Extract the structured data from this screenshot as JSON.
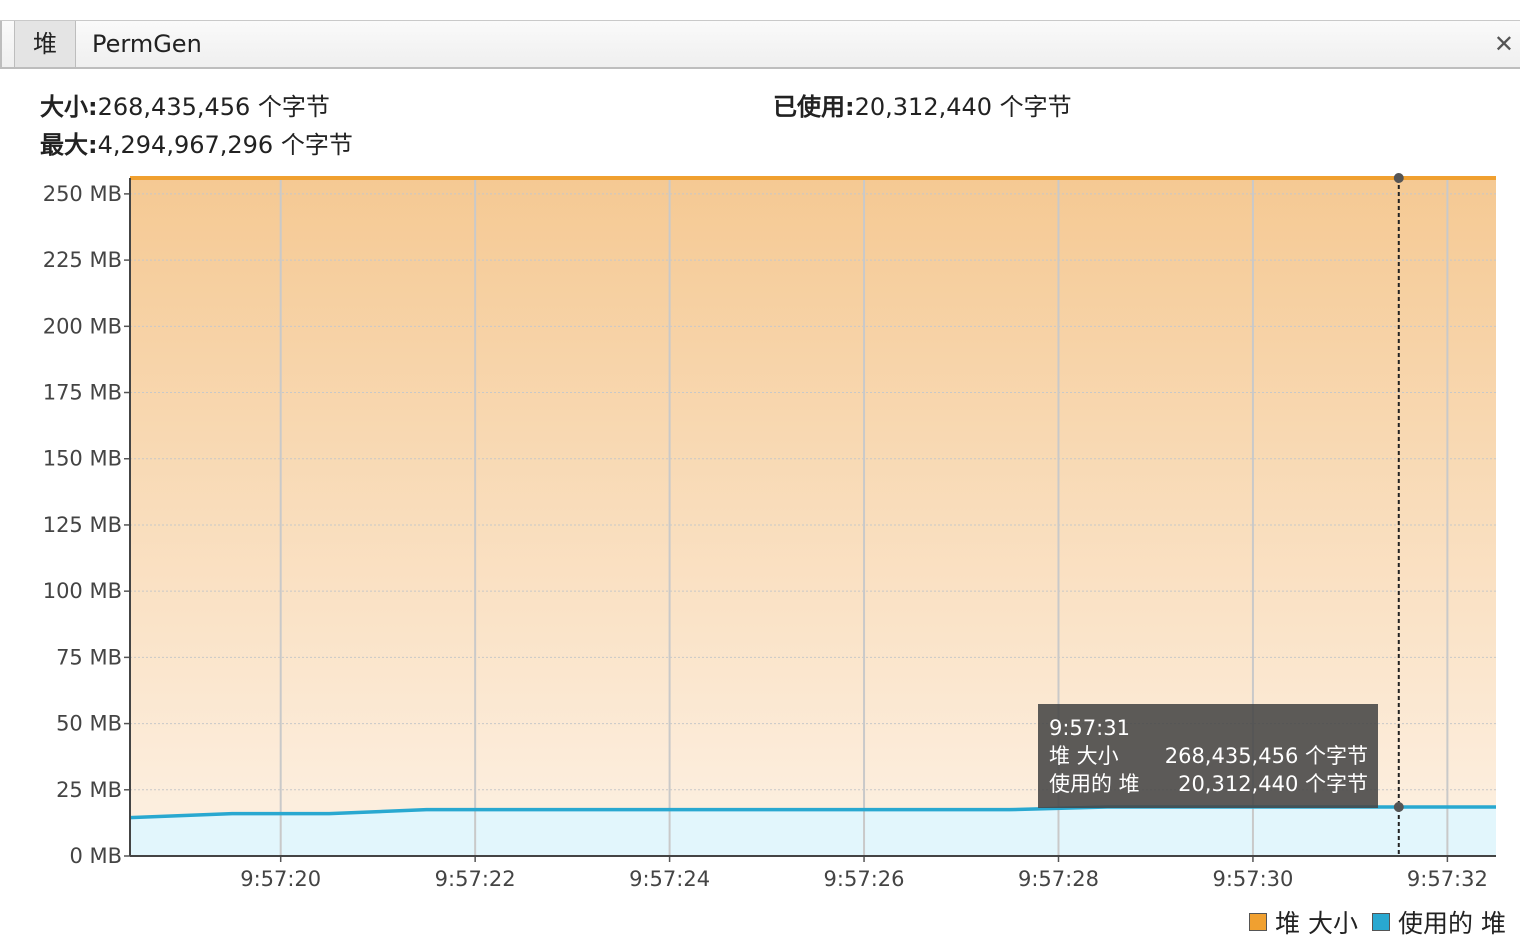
{
  "tabs": [
    {
      "label": "堆",
      "active": true
    },
    {
      "label": "PermGen",
      "active": false
    }
  ],
  "close_label": "✕",
  "stats": {
    "size_label": "大小:",
    "size_value": "268,435,456 个字节",
    "max_label": "最大:",
    "max_value": "4,294,967,296 个字节",
    "used_label": "已使用:",
    "used_value": "20,312,440 个字节"
  },
  "tooltip": {
    "time": "9:57:31",
    "row1_label": "堆 大小",
    "row1_value": "268,435,456 个字节",
    "row2_label": "使用的 堆",
    "row2_value": "20,312,440 个字节"
  },
  "legend": [
    {
      "label": "堆 大小",
      "color": "#f0a030"
    },
    {
      "label": "使用的 堆",
      "color": "#29a8d0"
    }
  ],
  "chart_data": {
    "type": "area",
    "x_ticks": [
      "9:57:20",
      "9:57:22",
      "9:57:24",
      "9:57:26",
      "9:57:28",
      "9:57:30",
      "9:57:32"
    ],
    "y_ticks": [
      "0 MB",
      "25 MB",
      "50 MB",
      "75 MB",
      "100 MB",
      "125 MB",
      "150 MB",
      "175 MB",
      "200 MB",
      "225 MB",
      "250 MB"
    ],
    "ylim": [
      0,
      256
    ],
    "xlim": [
      "9:57:18.45",
      "9:57:32.5"
    ],
    "series": [
      {
        "name": "堆 大小",
        "color": "#f0a030",
        "points": [
          [
            "9:57:18.45",
            256
          ],
          [
            "9:57:32.5",
            256
          ]
        ]
      },
      {
        "name": "使用的 堆",
        "color": "#29a8d0",
        "points": [
          [
            "9:57:18.45",
            14.5
          ],
          [
            "9:57:19.5",
            16
          ],
          [
            "9:57:20.5",
            16
          ],
          [
            "9:57:21.5",
            17.5
          ],
          [
            "9:57:27.5",
            17.5
          ],
          [
            "9:57:28.5",
            18.5
          ],
          [
            "9:57:32.5",
            18.5
          ]
        ]
      }
    ],
    "cursor_time": "9:57:31.5",
    "grid": true
  }
}
